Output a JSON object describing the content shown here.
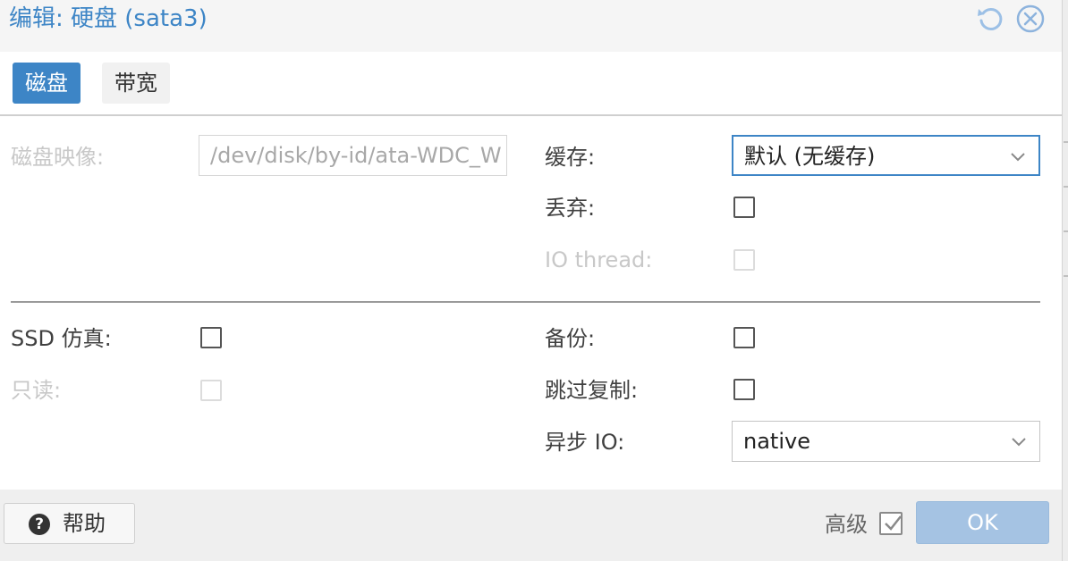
{
  "window": {
    "title": "编辑: 硬盘 (sata3)"
  },
  "tabs": [
    {
      "label": "磁盘",
      "active": true
    },
    {
      "label": "带宽",
      "active": false
    }
  ],
  "form": {
    "disk_image": {
      "label": "磁盘映像:",
      "value": "/dev/disk/by-id/ata-WDC_W",
      "disabled": true
    },
    "cache": {
      "label": "缓存:",
      "value": "默认 (无缓存)"
    },
    "discard": {
      "label": "丢弃:",
      "checked": false
    },
    "io_thread": {
      "label": "IO thread:",
      "checked": false,
      "disabled": true
    },
    "ssd_emulation": {
      "label": "SSD 仿真:",
      "checked": false
    },
    "read_only": {
      "label": "只读:",
      "checked": false,
      "disabled": true
    },
    "backup": {
      "label": "备份:",
      "checked": false
    },
    "skip_replication": {
      "label": "跳过复制:",
      "checked": false
    },
    "async_io": {
      "label": "异步 IO:",
      "value": "native"
    }
  },
  "footer": {
    "help_label": "帮助",
    "advanced_label": "高级",
    "advanced_checked": true,
    "ok_label": "OK"
  },
  "icons": {
    "reset": "undo-icon",
    "close": "close-icon",
    "help": "help-icon",
    "dropdown": "chevron-down-icon"
  },
  "colors": {
    "accent": "#3d85c6",
    "ok_button_disabled": "#a5c3e3",
    "disabled_text": "#c8c8c8"
  }
}
